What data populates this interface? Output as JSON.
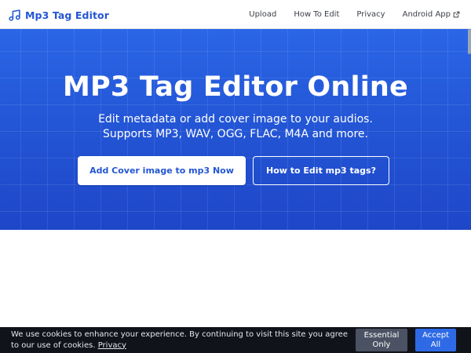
{
  "nav": {
    "brand": "Mp3 Tag Editor",
    "brand_icon": "music-note-icon",
    "links": {
      "upload": "Upload",
      "how_to_edit": "How To Edit",
      "privacy": "Privacy",
      "android_app": "Android App"
    },
    "external_icon": "external-link-icon"
  },
  "hero": {
    "title": "MP3 Tag Editor Online",
    "subtitle_line1": "Edit metadata or add cover image to your audios.",
    "subtitle_line2": "Supports MP3, WAV, OGG, FLAC, M4A and more.",
    "primary_button": "Add Cover image to mp3 Now",
    "secondary_button": "How to Edit mp3 tags?"
  },
  "cookie": {
    "message": "We use cookies to enhance your experience. By continuing to visit this site you agree to our use of cookies.",
    "link": "Privacy",
    "essential_button_line1": "Essential",
    "essential_button_line2": "Only",
    "accept_button_line1": "Accept",
    "accept_button_line2": "All"
  },
  "colors": {
    "brand": "#2456d3",
    "hero_background": "#2253d3",
    "cookie_background": "#11131a",
    "accept_button": "#2e6ae6",
    "essential_button": "#4a5263"
  }
}
